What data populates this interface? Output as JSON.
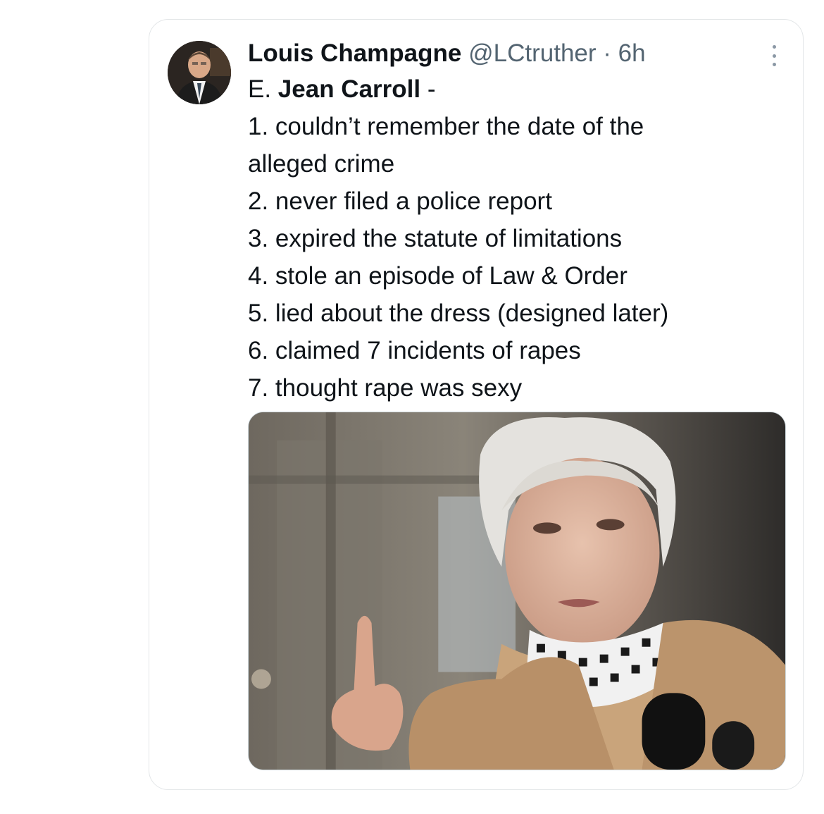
{
  "tweet": {
    "author": {
      "display_name": "Louis Champagne",
      "handle": "@LCtruther",
      "separator": "·",
      "time": "6h"
    },
    "subject_prefix": "E. ",
    "subject_bold": "Jean Carroll",
    "subject_suffix": " -",
    "lines": [
      "1. couldn’t remember the date of the",
      "alleged crime",
      "2. never filed a police report",
      "3. expired the statute of limitations",
      "4. stole an episode of Law & Order",
      "5. lied about the dress (designed later)",
      "6. claimed 7 incidents of rapes",
      "7. thought rape was sexy"
    ],
    "more_icon": "more-vertical-icon"
  }
}
